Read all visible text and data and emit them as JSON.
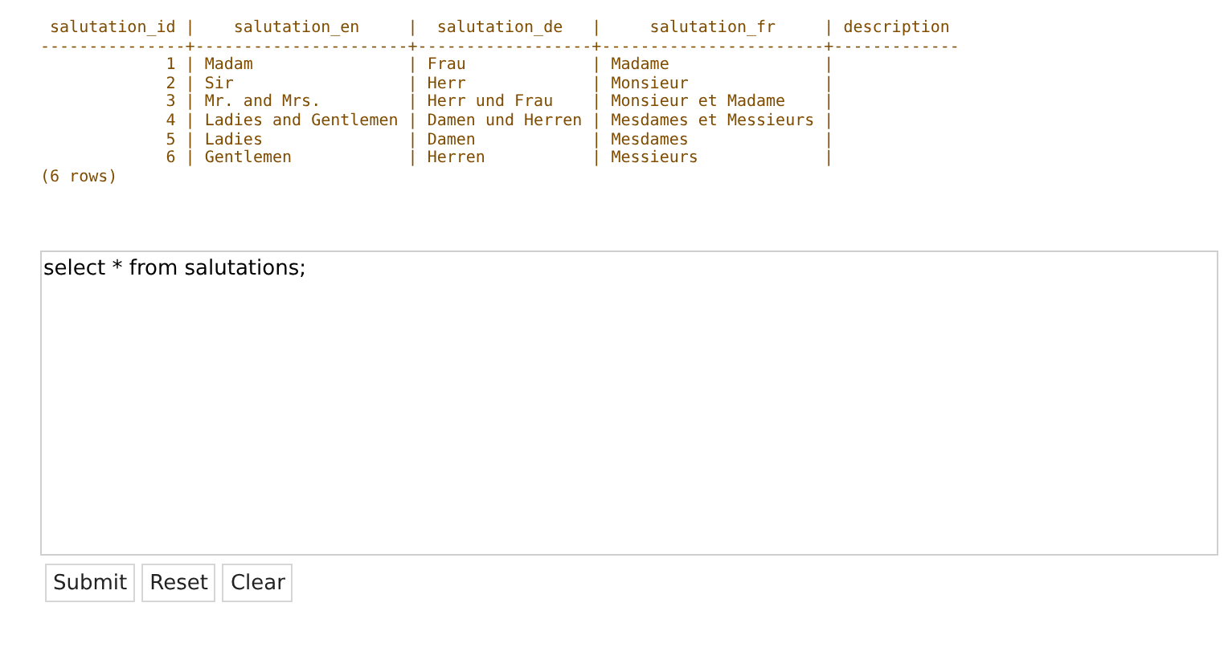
{
  "output_lines": [
    " salutation_id |    salutation_en     |  salutation_de   |     salutation_fr     | description",
    "---------------+----------------------+------------------+-----------------------+-------------",
    "             1 | Madam                | Frau             | Madame                |",
    "             2 | Sir                  | Herr             | Monsieur              |",
    "             3 | Mr. and Mrs.         | Herr und Frau    | Monsieur et Madame    |",
    "             4 | Ladies and Gentlemen | Damen und Herren | Mesdames et Messieurs |",
    "             5 | Ladies               | Damen            | Mesdames              |",
    "             6 | Gentlemen            | Herren           | Messieurs             |",
    "(6 rows)"
  ],
  "query": {
    "value": "select * from salutations;"
  },
  "buttons": [
    {
      "label": "Submit"
    },
    {
      "label": "Reset"
    },
    {
      "label": "Clear"
    }
  ]
}
